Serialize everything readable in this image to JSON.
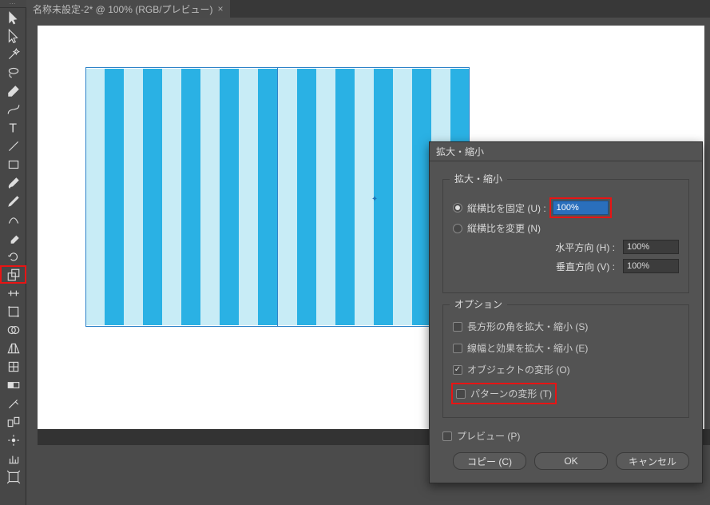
{
  "tabs": {
    "title": "名称未設定-2* @ 100% (RGB/プレビュー)"
  },
  "tools": [
    {
      "name": "selection-tool",
      "icon": "sel"
    },
    {
      "name": "direct-selection-tool",
      "icon": "dsel"
    },
    {
      "name": "magic-wand-tool",
      "icon": "wand"
    },
    {
      "name": "lasso-tool",
      "icon": "lasso"
    },
    {
      "name": "pen-tool",
      "icon": "pen"
    },
    {
      "name": "curve-tool",
      "icon": "curve"
    },
    {
      "name": "type-tool",
      "icon": "type"
    },
    {
      "name": "line-tool",
      "icon": "line"
    },
    {
      "name": "rect-tool",
      "icon": "rect"
    },
    {
      "name": "brush-tool",
      "icon": "brush"
    },
    {
      "name": "pencil-tool",
      "icon": "pencil"
    },
    {
      "name": "shaper-tool",
      "icon": "shaper"
    },
    {
      "name": "eraser-tool",
      "icon": "eraser"
    },
    {
      "name": "rotate-tool",
      "icon": "rotate"
    },
    {
      "name": "scale-tool",
      "icon": "scale",
      "selected": true
    },
    {
      "name": "width-tool",
      "icon": "width"
    },
    {
      "name": "free-transform-tool",
      "icon": "ftrans"
    },
    {
      "name": "shape-builder-tool",
      "icon": "sbuild"
    },
    {
      "name": "perspective-tool",
      "icon": "persp"
    },
    {
      "name": "mesh-tool",
      "icon": "mesh"
    },
    {
      "name": "gradient-tool",
      "icon": "grad"
    },
    {
      "name": "eyedropper-tool",
      "icon": "eye"
    },
    {
      "name": "blend-tool",
      "icon": "blend"
    },
    {
      "name": "symbol-tool",
      "icon": "sym"
    },
    {
      "name": "graph-tool",
      "icon": "graph"
    },
    {
      "name": "artboard-tool",
      "icon": "art"
    }
  ],
  "dialog": {
    "title": "拡大・縮小",
    "section_scale": "拡大・縮小",
    "radio_lock_label": "縦横比を固定 (U) :",
    "radio_lock_value": "100%",
    "radio_change_label": "縦横比を変更 (N)",
    "h_label": "水平方向 (H) :",
    "h_value": "100%",
    "v_label": "垂直方向 (V) :",
    "v_value": "100%",
    "section_options": "オプション",
    "opt_corner": "長方形の角を拡大・縮小 (S)",
    "opt_stroke": "線幅と効果を拡大・縮小 (E)",
    "opt_object": "オブジェクトの変形 (O)",
    "opt_pattern": "パターンの変形 (T)",
    "preview": "プレビュー (P)",
    "btn_copy": "コピー (C)",
    "btn_ok": "OK",
    "btn_cancel": "キャンセル"
  }
}
